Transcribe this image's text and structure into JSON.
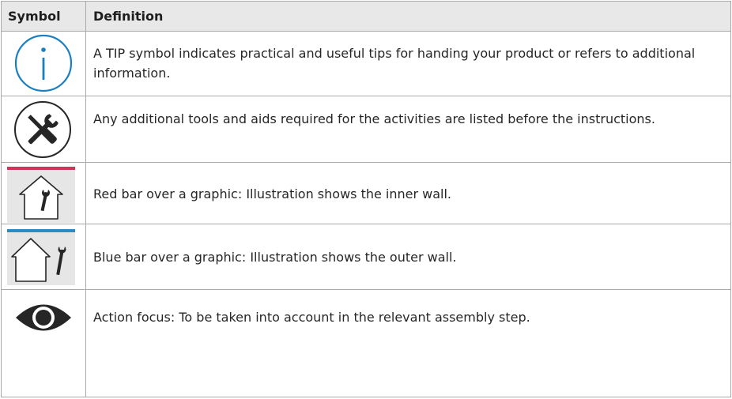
{
  "header": {
    "symbol": "Symbol",
    "definition": "Definition"
  },
  "rows": [
    {
      "icon": "info-circle-icon",
      "text": "A TIP symbol indicates practical and useful tips for handing your product or refers to additional information."
    },
    {
      "icon": "tools-icon",
      "text": "Any additional tools and aids required for the activities are listed before the instructions."
    },
    {
      "icon": "house-inner-wall-icon",
      "text": "Red bar over a graphic: Illustration shows the inner wall."
    },
    {
      "icon": "house-outer-wall-icon",
      "text": "Blue bar over a graphic: Illustration shows the outer wall."
    },
    {
      "icon": "eye-icon",
      "text": "Action focus: To be taken into account in the relevant assembly step."
    }
  ],
  "colors": {
    "info": "#1a7fc1",
    "red_bar": "#d0345a",
    "blue_bar": "#2b8cc4",
    "header_bg": "#e8e8e8"
  }
}
